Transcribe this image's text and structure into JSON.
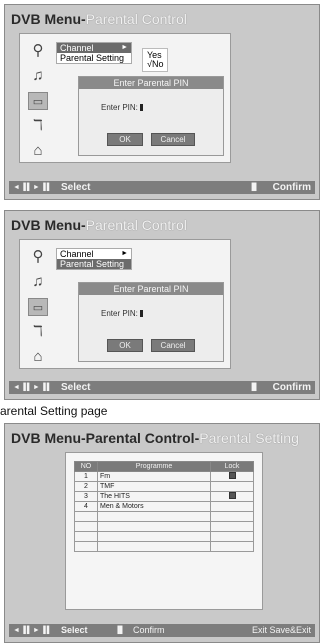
{
  "screen1": {
    "title_main": "DVB Menu-",
    "title_sub": "Parental Control",
    "menu": [
      {
        "label": "Channel"
      },
      {
        "label": "Parental Setting"
      }
    ],
    "yesno": [
      "Yes",
      "√No"
    ],
    "dialog": {
      "title": "Enter Parental PIN",
      "label": "Enter PIN:",
      "ok": "OK",
      "cancel": "Cancel"
    },
    "bar": {
      "keys": "◄▐▌►▐▌",
      "select": "Select",
      "confirm_key": "▐▌",
      "confirm": "Confirm"
    }
  },
  "screen2": {
    "title_main": "DVB Menu-",
    "title_sub": "Parental Control",
    "menu": [
      {
        "label": "Channel"
      },
      {
        "label": "Parental Setting"
      }
    ],
    "dialog": {
      "title": "Enter Parental PIN",
      "label": "Enter PIN:",
      "ok": "OK",
      "cancel": "Cancel"
    },
    "bar": {
      "keys": "◄▐▌►▐▌",
      "select": "Select",
      "confirm_key": "▐▌",
      "confirm": "Confirm"
    }
  },
  "caption": "arental Setting page",
  "screen3": {
    "title_main": "DVB Menu-Parental Control-",
    "title_sub": "Parental Setting",
    "table": {
      "headers": [
        "NO",
        "Programme",
        "Lock"
      ],
      "rows": [
        {
          "no": "1",
          "name": "Fm",
          "locked": true
        },
        {
          "no": "2",
          "name": "TMF",
          "locked": false
        },
        {
          "no": "3",
          "name": "The HITS",
          "locked": true
        },
        {
          "no": "4",
          "name": "Men & Motors",
          "locked": false
        },
        {
          "no": "",
          "name": "",
          "locked": false
        },
        {
          "no": "",
          "name": "",
          "locked": false
        },
        {
          "no": "",
          "name": "",
          "locked": false
        },
        {
          "no": "",
          "name": "",
          "locked": false
        }
      ]
    },
    "bar": {
      "keys": "◄▐▌►▐▌",
      "select": "Select",
      "confirm_key": "▐▌",
      "confirm": "Confirm",
      "exit": "Exit  Save&Exit"
    }
  },
  "icons": [
    "magnifier-icon",
    "microphone-icon",
    "tv-icon",
    "key-icon",
    "lock-icon"
  ]
}
